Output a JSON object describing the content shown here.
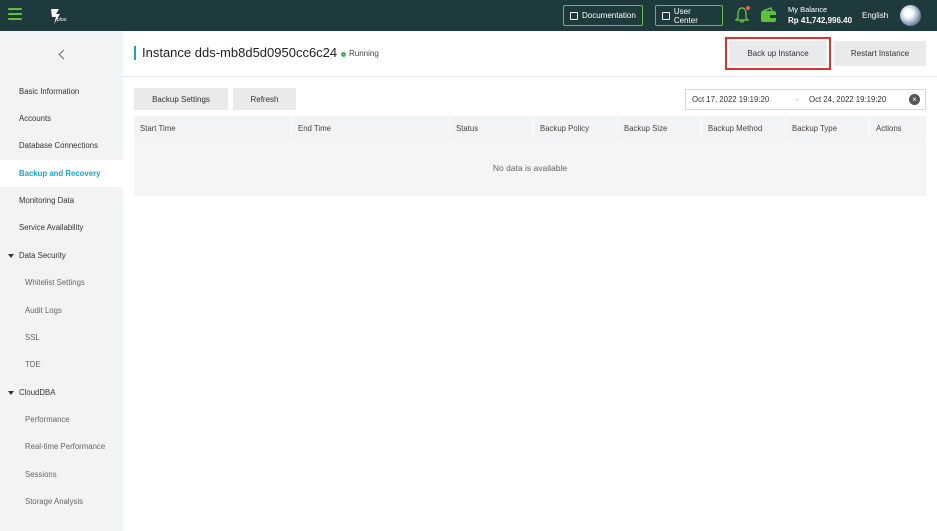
{
  "topbar": {
    "logo_text": "plou",
    "documentation_label": "Documentation",
    "user_center_label": "User Center",
    "balance_label": "My Balance",
    "balance_value": "Rp 41,742,996.40",
    "language": "English"
  },
  "sidebar": {
    "items": [
      {
        "label": "Basic Information"
      },
      {
        "label": "Accounts"
      },
      {
        "label": "Database Connections"
      },
      {
        "label": "Backup and Recovery"
      },
      {
        "label": "Monitoring Data"
      },
      {
        "label": "Service Availability"
      }
    ],
    "group_data_security": "Data Security",
    "data_security_items": [
      {
        "label": "Whitelist Settings"
      },
      {
        "label": "Audit Logs"
      },
      {
        "label": "SSL"
      },
      {
        "label": "TDE"
      }
    ],
    "group_clouddba": "CloudDBA",
    "clouddba_items": [
      {
        "label": "Performance"
      },
      {
        "label": "Real-time Performance"
      },
      {
        "label": "Sessions"
      },
      {
        "label": "Storage Analysis"
      }
    ]
  },
  "header": {
    "title": "Instance dds-mb8d5d0950cc6c24",
    "status": "Running",
    "backup_button": "Back up Instance",
    "restart_button": "Restart Instance"
  },
  "toolbar": {
    "backup_settings": "Backup Settings",
    "refresh": "Refresh",
    "date_start": "Oct 17, 2022 19:19:20",
    "date_sep": "-",
    "date_end": "Oct 24, 2022 19:19:20"
  },
  "table": {
    "columns": [
      "Start Time",
      "End Time",
      "Status",
      "Backup Policy",
      "Backup Size",
      "Backup Method",
      "Backup Type",
      "Actions"
    ],
    "empty_text": "No data is available"
  },
  "colors": {
    "topbar_bg": "#1f3a3c",
    "accent_green": "#5ec234",
    "active_blue": "#1ba3cf",
    "highlight_red": "#e0312f",
    "running_green": "#4cb050"
  }
}
